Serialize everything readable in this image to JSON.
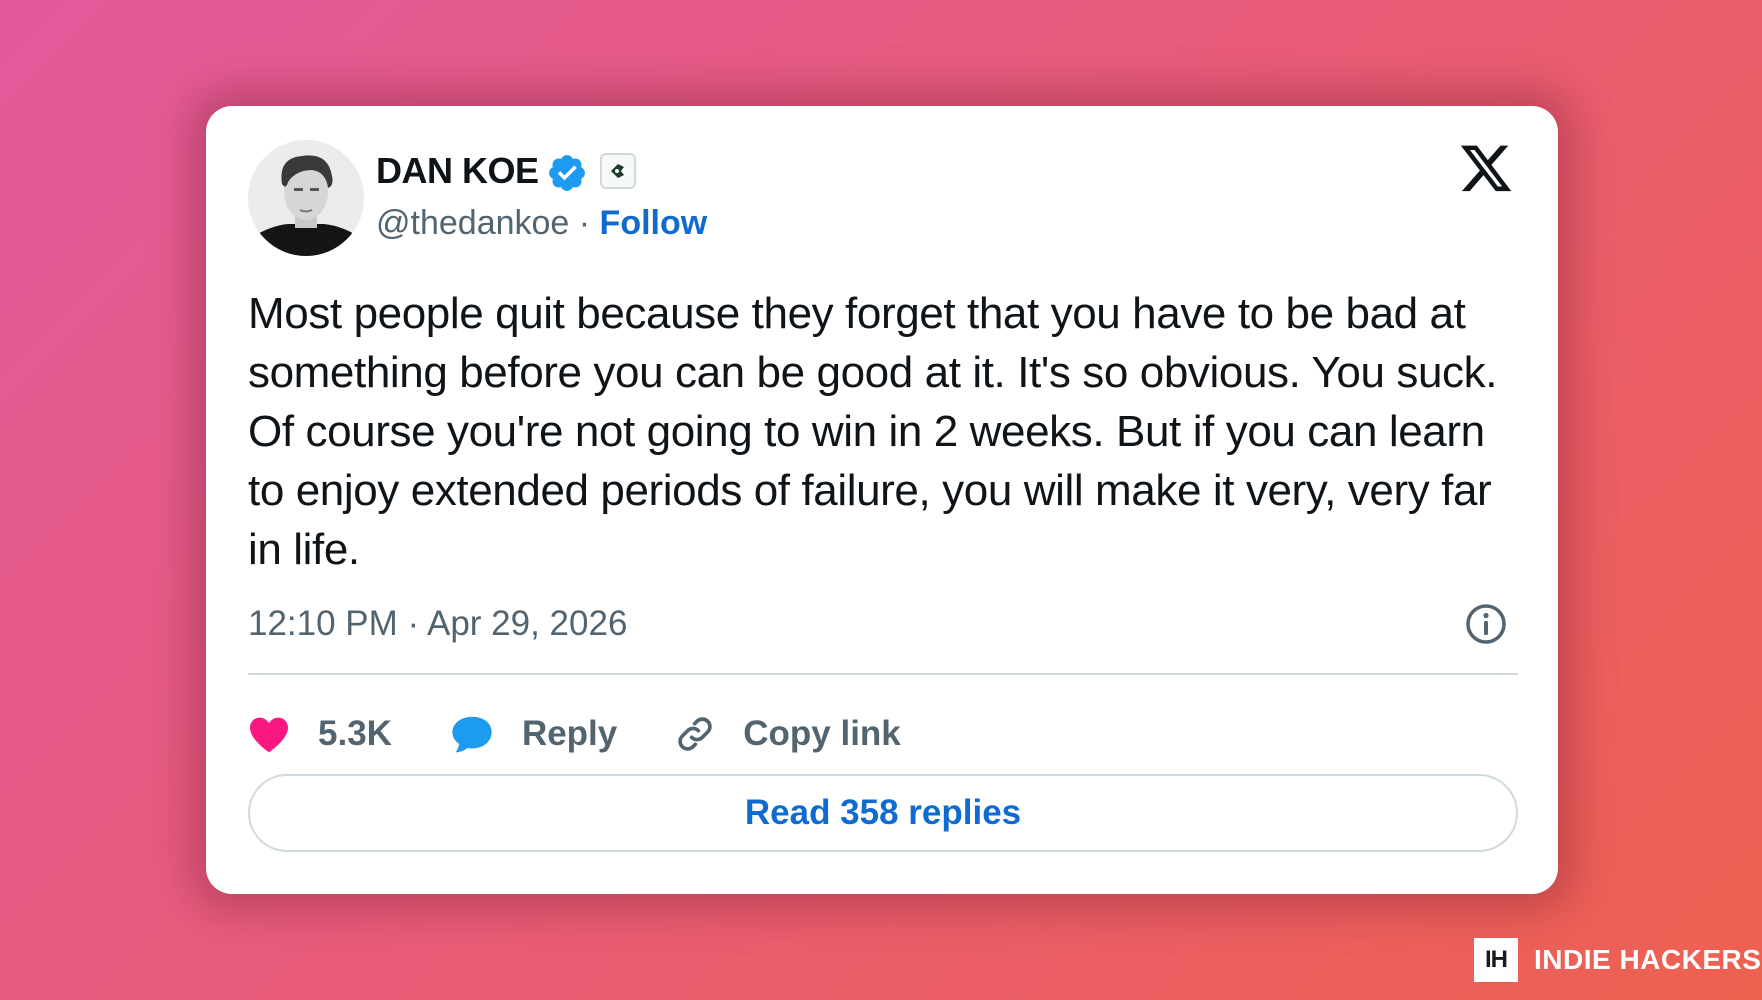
{
  "tweet": {
    "author_name": "DAN KOE",
    "handle": "@thedankoe",
    "separator": " · ",
    "follow_label": "Follow",
    "text": "Most people quit because they forget that you have to be bad at something before you can be good at it. It's so obvious. You suck. Of course you're not going to win in 2 weeks. But if you can learn to enjoy extended periods of failure, you will make it very, very far in life.",
    "timestamp": "12:10 PM · Apr 29, 2026"
  },
  "actions": {
    "likes": "5.3K",
    "reply_label": "Reply",
    "copy_label": "Copy link"
  },
  "read_replies_label": "Read 358 replies",
  "watermark": {
    "logo_text": "IH",
    "brand": "INDIE HACKERS"
  },
  "icons": {
    "verified": "verified-badge-icon",
    "affiliate": "affiliate-badge-icon",
    "brand": "x-logo-icon",
    "info": "info-icon",
    "like": "heart-icon",
    "reply": "speech-bubble-icon",
    "copy": "link-icon"
  },
  "colors": {
    "accent": "#0f6bd0",
    "verified": "#1d9bf0",
    "heart": "#f91880",
    "text": "#0f1419",
    "secondary": "#536471",
    "background_start": "#e35a9c",
    "background_end": "#ee6150"
  }
}
